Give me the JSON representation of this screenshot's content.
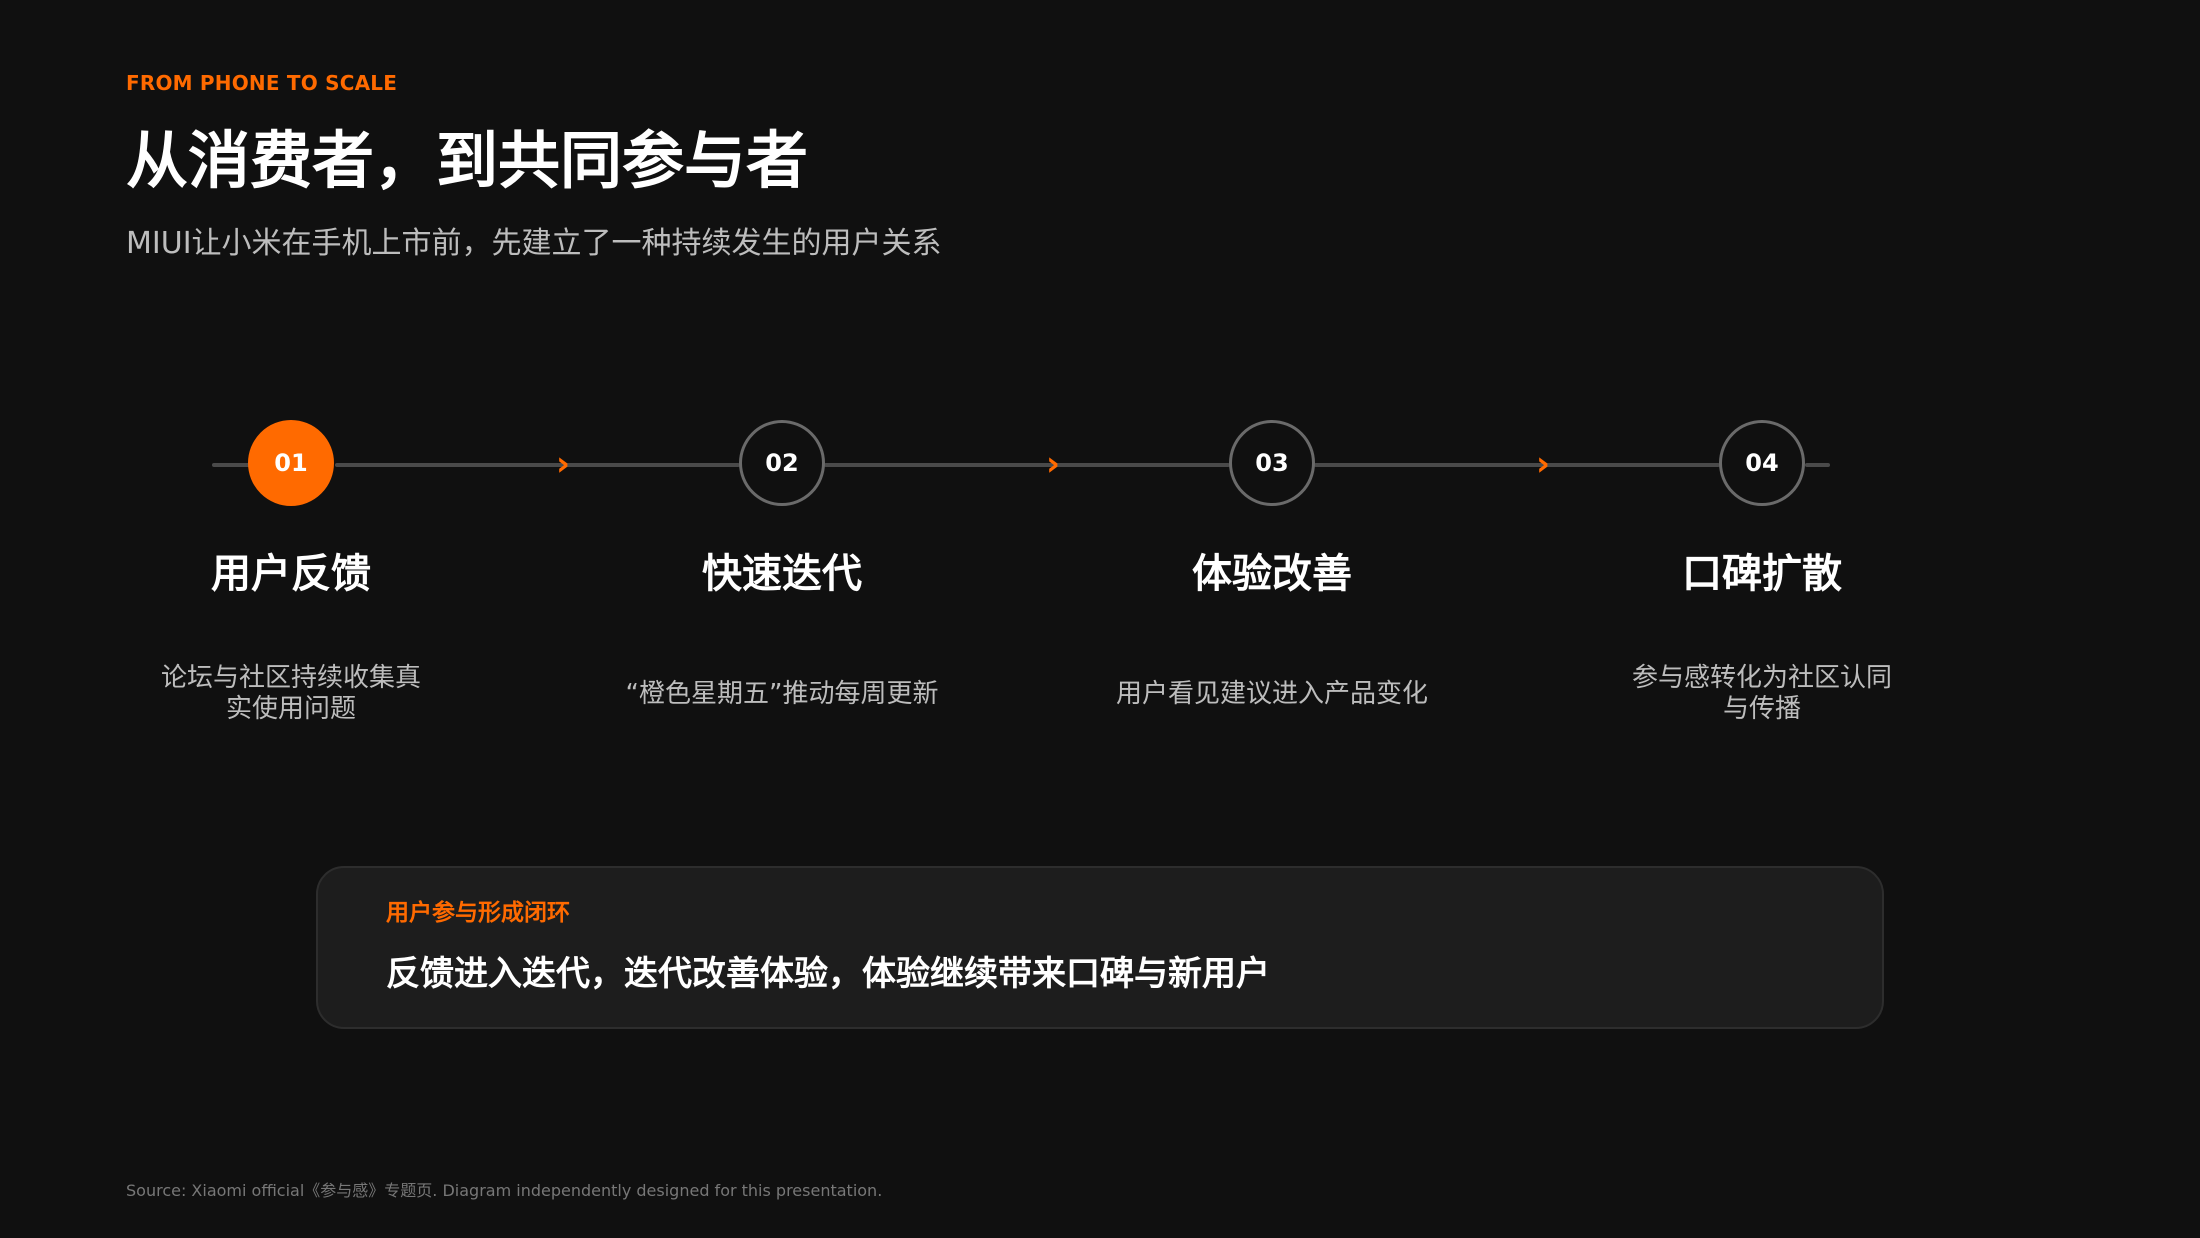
{
  "slide": {
    "eyebrow": "FROM PHONE TO SCALE",
    "title": "从消费者，到共同参与者",
    "subtitle": "MIUI让小米在手机上市前，先建立了一种持续发生的用户关系"
  },
  "steps": [
    {
      "number": "01",
      "title": "用户反馈",
      "description": "论坛与社区持续收集真实使用问题",
      "active": true
    },
    {
      "number": "02",
      "title": "快速迭代",
      "description": "“橙色星期五”推动每周更新",
      "active": false
    },
    {
      "number": "03",
      "title": "体验改善",
      "description": "用户看见建议进入产品变化",
      "active": false
    },
    {
      "number": "04",
      "title": "口碑扩散",
      "description": "参与感转化为社区认同与传播",
      "active": false
    }
  ],
  "loop": {
    "label": "用户参与形成闭环",
    "text": "反馈进入迭代，迭代改善体验，体验继续带来口碑与新用户"
  },
  "footer": {
    "source": "Source: Xiaomi official《参与感》专题页. Diagram independently designed for this presentation."
  },
  "colors": {
    "background": "#101010",
    "accent": "#ff6a00",
    "text": "#ffffff",
    "muted_text": "#bdbdbd",
    "card": "#1d1d1d",
    "track": "#4a4a4a"
  },
  "icons": {
    "step_arrow": "chevron-right-icon"
  }
}
